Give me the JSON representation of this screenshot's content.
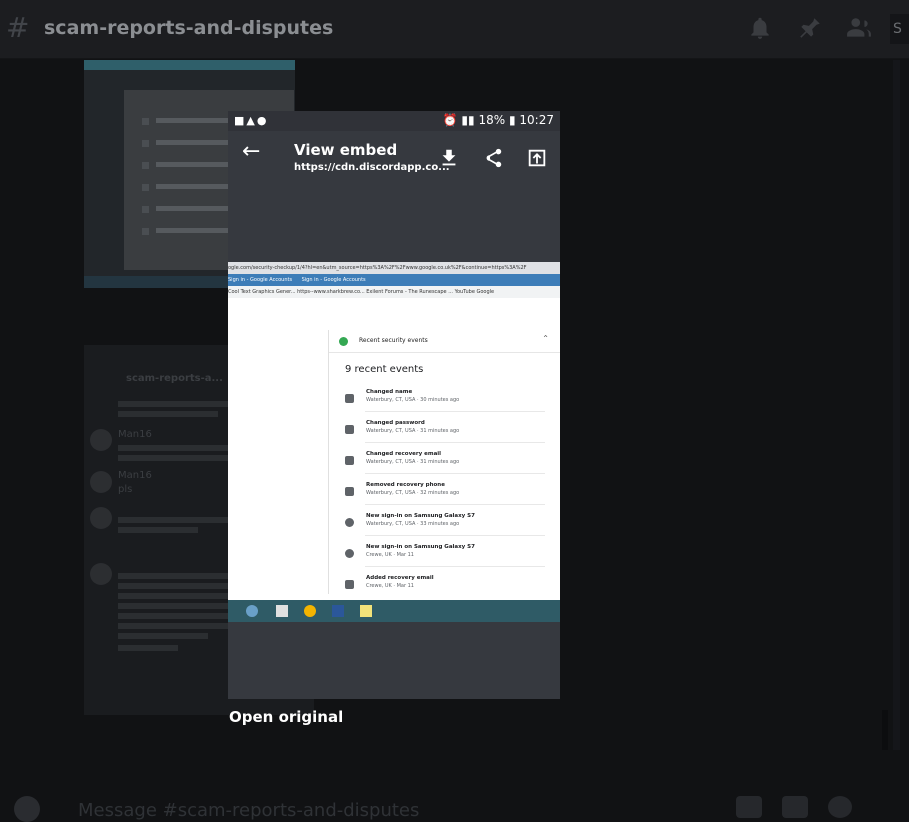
{
  "channel": {
    "name": "scam-reports-and-disputes",
    "search_stub": "S"
  },
  "background_chat": {
    "channel_label": "scam-reports-a...",
    "messages": [
      {
        "author": "Man16",
        "text": "pls"
      },
      {
        "author": "Man16",
        "text": ""
      }
    ]
  },
  "composer": {
    "placeholder": "Message #scam-reports-and-disputes"
  },
  "phone": {
    "status_bar": {
      "battery": "18%",
      "time": "10:27"
    },
    "app_bar": {
      "title": "View embed",
      "subtitle": "https://cdn.discordapp.co..."
    },
    "embed": {
      "url_text": "ogle.com/security-checkup/1/4?hl=en&utm_source=https%3A%2F%2Fwww.google.co.uk%2F&continue=https%3A%2F",
      "tabs": [
        "Sign in - Google Accounts",
        "Sign in - Google Accounts"
      ],
      "bookmarks": "Cool Text Graphics Gener...   https--www.sharkbrew.co...   Exilent   Forums - The Runescape ...   YouTube   Google",
      "section_title": "Recent security events",
      "events_count": "9 recent events",
      "events": [
        {
          "name": "Changed name",
          "detail": "Waterbury, CT, USA · 30 minutes ago",
          "icon": "wrench-icon"
        },
        {
          "name": "Changed password",
          "detail": "Waterbury, CT, USA · 31 minutes ago",
          "icon": "key-icon"
        },
        {
          "name": "Changed recovery email",
          "detail": "Waterbury, CT, USA · 31 minutes ago",
          "icon": "lock-icon"
        },
        {
          "name": "Removed recovery phone",
          "detail": "Waterbury, CT, USA · 32 minutes ago",
          "icon": "lock-icon"
        },
        {
          "name": "New sign-in on Samsung Galaxy S7",
          "detail": "Waterbury, CT, USA · 33 minutes ago",
          "icon": "shield-icon"
        },
        {
          "name": "New sign-in on Samsung Galaxy S7",
          "detail": "Crewe, UK · Mar 11",
          "icon": "shield-icon"
        },
        {
          "name": "Added recovery email",
          "detail": "Crewe, UK · Mar 11",
          "icon": "lock-icon"
        }
      ]
    }
  },
  "open_original_label": "Open original",
  "colors": {
    "overlay_bg": "#111214",
    "phone_bg": "#36393f",
    "accent_green": "#34a853",
    "taskbar": "#2f5b66"
  }
}
